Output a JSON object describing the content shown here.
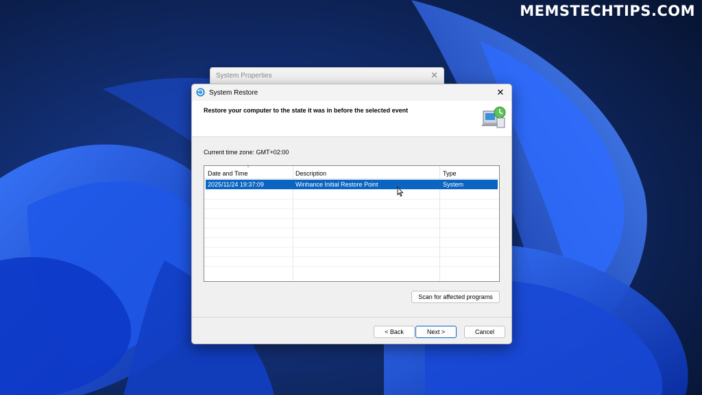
{
  "watermark": "MEMSTECHTIPS.COM",
  "background_window": {
    "title": "System Properties",
    "close_glyph": "✕"
  },
  "window": {
    "title": "System Restore",
    "close_glyph": "✕",
    "title_icon": "system-restore-icon",
    "header_icon": "computer-restore-icon"
  },
  "header": {
    "text": "Restore your computer to the state it was in before the selected event"
  },
  "timezone": {
    "label": "Current time zone: GMT+02:00"
  },
  "table": {
    "columns": [
      "Date and Time",
      "Description",
      "Type"
    ],
    "rows": [
      {
        "date": "2025/11/24 19:37:09",
        "description": "Winhance Initial Restore Point",
        "type": "System",
        "selected": true
      }
    ]
  },
  "buttons": {
    "scan": "Scan for affected programs",
    "back": "< Back",
    "next": "Next >",
    "cancel": "Cancel"
  },
  "colors": {
    "selection": "#0a64c2",
    "wallpaper_dark": "#0b1a3e",
    "wallpaper_bloom": "#1d4fe0"
  }
}
